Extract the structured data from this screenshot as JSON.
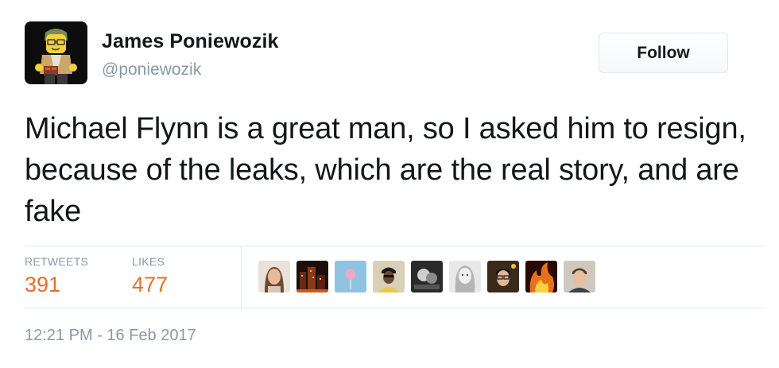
{
  "author": {
    "name": "James Poniewozik",
    "handle": "@poniewozik",
    "avatar_icon": "lego-figure-avatar"
  },
  "follow_button": {
    "label": "Follow"
  },
  "tweet": {
    "text": "Michael Flynn is a great man, so I asked him to resign, because of the leaks, which are the real story, and are fake",
    "timestamp": "12:21 PM - 16 Feb 2017"
  },
  "stats": {
    "retweets_label": "RETWEETS",
    "retweets_value": "391",
    "likes_label": "LIKES",
    "likes_value": "477",
    "value_color": "#e0702c"
  },
  "likers": [
    {
      "icon": "woman-portrait-avatar"
    },
    {
      "icon": "city-night-avatar"
    },
    {
      "icon": "balloon-avatar"
    },
    {
      "icon": "man-cap-avatar"
    },
    {
      "icon": "bw-photo-avatar"
    },
    {
      "icon": "woman-bw-avatar"
    },
    {
      "icon": "man-glasses-avatar"
    },
    {
      "icon": "fire-avatar"
    },
    {
      "icon": "man-portrait-avatar"
    }
  ]
}
